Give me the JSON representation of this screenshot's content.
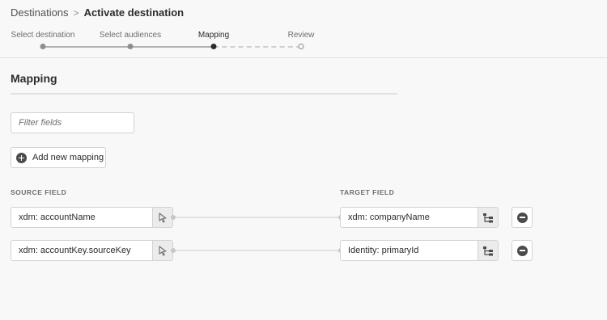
{
  "breadcrumb": {
    "parent": "Destinations",
    "separator": ">",
    "current": "Activate destination"
  },
  "stepper": {
    "steps": [
      {
        "label": "Select destination",
        "state": "done"
      },
      {
        "label": "Select audiences",
        "state": "done"
      },
      {
        "label": "Mapping",
        "state": "active"
      },
      {
        "label": "Review",
        "state": "todo"
      }
    ]
  },
  "section": {
    "title": "Mapping"
  },
  "filter": {
    "placeholder": "Filter fields"
  },
  "add_mapping": {
    "label": "Add new mapping",
    "icon": "add-circle-icon"
  },
  "columns": {
    "source": "SOURCE FIELD",
    "target": "TARGET FIELD"
  },
  "mappings": [
    {
      "source": "xdm: accountName",
      "target": "xdm: companyName"
    },
    {
      "source": "xdm: accountKey.sourceKey",
      "target": "Identity: primaryId"
    }
  ],
  "icons": {
    "source_picker": "pointer-select-icon",
    "target_picker": "schema-tree-icon",
    "remove": "remove-circle-icon"
  },
  "colors": {
    "accent": "#2c2c2c",
    "background": "#f8f8f8"
  }
}
